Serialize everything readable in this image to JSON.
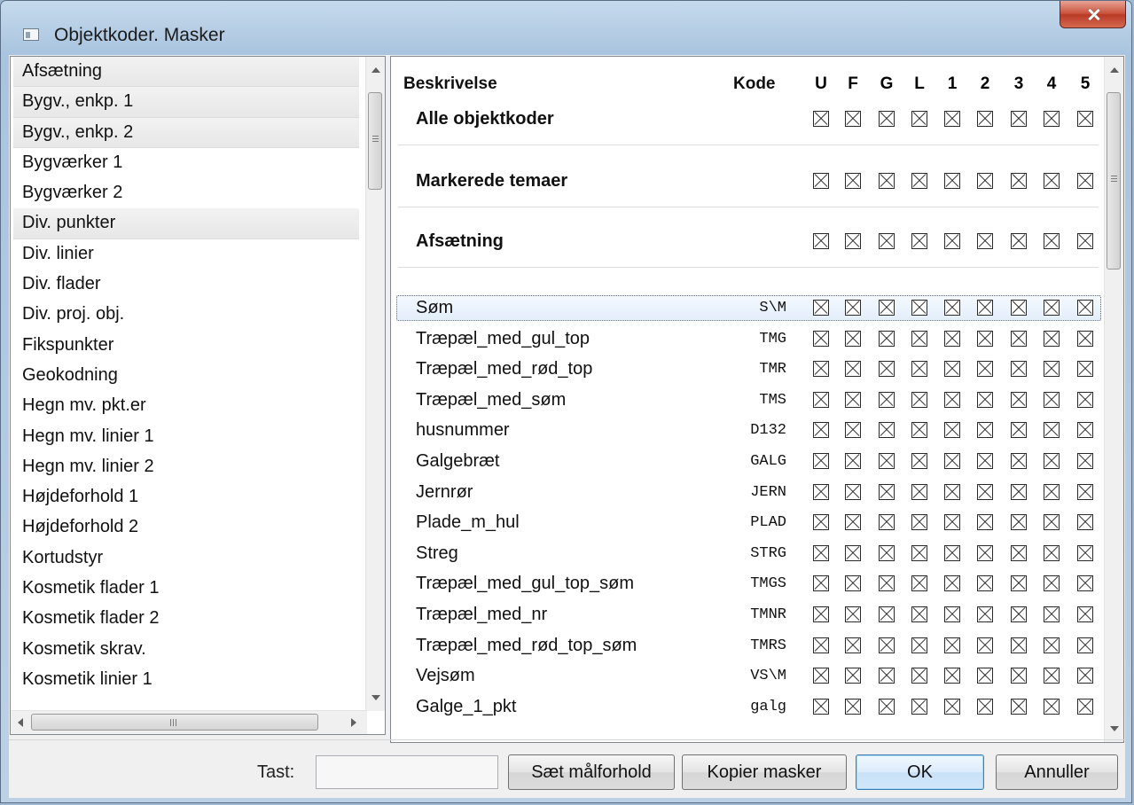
{
  "window": {
    "title": "Objektkoder. Masker"
  },
  "left_list": {
    "items": [
      {
        "label": "Afsætning",
        "style": "alt"
      },
      {
        "label": "Bygv., enkp. 1",
        "style": "alt"
      },
      {
        "label": "Bygv., enkp. 2",
        "style": "alt"
      },
      {
        "label": "Bygværker 1",
        "style": ""
      },
      {
        "label": "Bygværker 2",
        "style": ""
      },
      {
        "label": "Div. punkter",
        "style": "alt"
      },
      {
        "label": "Div. linier",
        "style": ""
      },
      {
        "label": "Div. flader",
        "style": ""
      },
      {
        "label": "Div. proj. obj.",
        "style": ""
      },
      {
        "label": "Fikspunkter",
        "style": ""
      },
      {
        "label": "Geokodning",
        "style": ""
      },
      {
        "label": "Hegn mv. pkt.er",
        "style": ""
      },
      {
        "label": "Hegn mv. linier 1",
        "style": ""
      },
      {
        "label": "Hegn mv. linier 2",
        "style": ""
      },
      {
        "label": "Højdeforhold 1",
        "style": ""
      },
      {
        "label": "Højdeforhold 2",
        "style": ""
      },
      {
        "label": "Kortudstyr",
        "style": ""
      },
      {
        "label": "Kosmetik flader 1",
        "style": ""
      },
      {
        "label": "Kosmetik flader 2",
        "style": ""
      },
      {
        "label": "Kosmetik skrav.",
        "style": ""
      },
      {
        "label": "Kosmetik linier 1",
        "style": ""
      }
    ]
  },
  "grid": {
    "header": {
      "description": "Beskrivelse",
      "code": "Kode",
      "columns": [
        "U",
        "F",
        "G",
        "L",
        "1",
        "2",
        "3",
        "4",
        "5"
      ]
    },
    "groups": [
      {
        "label": "Alle objektkoder"
      },
      {
        "label": "Markerede temaer"
      },
      {
        "label": "Afsætning"
      }
    ],
    "rows": [
      {
        "label": "Søm",
        "code": "S\\M",
        "selected": true
      },
      {
        "label": "Træpæl_med_gul_top",
        "code": "TMG"
      },
      {
        "label": "Træpæl_med_rød_top",
        "code": "TMR"
      },
      {
        "label": "Træpæl_med_søm",
        "code": "TMS"
      },
      {
        "label": "husnummer",
        "code": "D132"
      },
      {
        "label": "Galgebræt",
        "code": "GALG"
      },
      {
        "label": "Jernrør",
        "code": "JERN"
      },
      {
        "label": "Plade_m_hul",
        "code": "PLAD"
      },
      {
        "label": "Streg",
        "code": "STRG"
      },
      {
        "label": "Træpæl_med_gul_top_søm",
        "code": "TMGS"
      },
      {
        "label": "Træpæl_med_nr",
        "code": "TMNR"
      },
      {
        "label": "Træpæl_med_rød_top_søm",
        "code": "TMRS"
      },
      {
        "label": "Vejsøm",
        "code": "VS\\M"
      },
      {
        "label": "Galge_1_pkt",
        "code": "galg"
      }
    ]
  },
  "footer": {
    "tast_label": "Tast:",
    "tast_value": "",
    "buttons": {
      "set_scale": "Sæt målforhold",
      "copy_masks": "Kopier masker",
      "ok": "OK",
      "cancel": "Annuller"
    }
  },
  "scrollbars": {
    "left_list_vertical_position": 0.0,
    "left_list_horizontal_position": 0.0,
    "grid_vertical_position": 0.0
  }
}
